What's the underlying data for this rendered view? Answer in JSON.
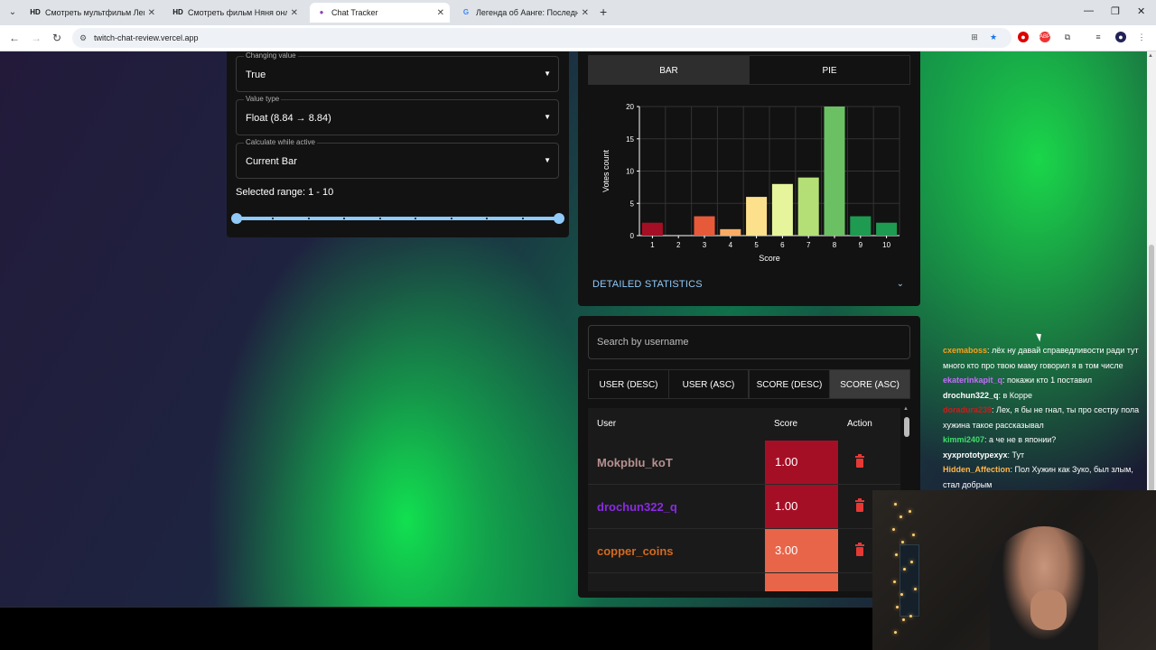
{
  "browser": {
    "tabs": [
      {
        "favicon": "HD",
        "title": "Смотреть мультфильм Легенд"
      },
      {
        "favicon": "HD",
        "title": "Смотреть фильм Няня онлайн"
      },
      {
        "favicon": "chat-tracker-icon",
        "title": "Chat Tracker"
      },
      {
        "favicon": "G",
        "title": "Легенда об Аанге: Последний"
      }
    ],
    "url": "twitch-chat-review.vercel.app"
  },
  "settings": {
    "changing_value_label": "Changing value",
    "changing_value": "True",
    "value_type_label": "Value type",
    "value_type": "Float (8.84 → 8.84)",
    "calculate_label": "Calculate while active",
    "calculate_value": "Current Bar",
    "range_text": "Selected range: 1 - 10",
    "range_min": 1,
    "range_max": 10
  },
  "chart_panel": {
    "tab_bar": "BAR",
    "tab_pie": "PIE",
    "details_label": "DETAILED STATISTICS"
  },
  "chart_data": {
    "type": "bar",
    "categories": [
      "1",
      "2",
      "3",
      "4",
      "5",
      "6",
      "7",
      "8",
      "9",
      "10"
    ],
    "values": [
      2,
      0,
      3,
      1,
      6,
      8,
      9,
      20,
      3,
      2
    ],
    "colors": [
      "#a50f26",
      "#a50f26",
      "#e65a3a",
      "#fbac64",
      "#fde08c",
      "#e6f59b",
      "#b4df77",
      "#6cc064",
      "#1e9b50",
      "#1e9b50"
    ],
    "xlabel": "Score",
    "ylabel": "Votes count",
    "ylim": [
      0,
      20
    ],
    "yticks": [
      0,
      5,
      10,
      15,
      20
    ],
    "grid": true
  },
  "table": {
    "search_placeholder": "Search by username",
    "sort_buttons": [
      "USER (DESC)",
      "USER (ASC)",
      "SCORE (DESC)",
      "SCORE (ASC)"
    ],
    "columns": [
      "User",
      "Score",
      "Action"
    ],
    "rows": [
      {
        "user": "Mokpblu_koT",
        "score": "1.00",
        "user_color": "#b89090",
        "score_color": "#a50f26"
      },
      {
        "user": "drochun322_q",
        "score": "1.00",
        "user_color": "#8a2be2",
        "score_color": "#a50f26"
      },
      {
        "user": "copper_coins",
        "score": "3.00",
        "user_color": "#d2691e",
        "score_color": "#e8654a"
      }
    ]
  },
  "chat": [
    {
      "nick": "cxemaboss",
      "text": "лёх ну давай справедливости ради тут много кто про твою маму говорил я в том числе",
      "color": "#ff9f1a"
    },
    {
      "nick": "ekaterinkapit_q",
      "text": "покажи кто 1 поставил",
      "color": "#c86bff"
    },
    {
      "nick": "drochun322_q",
      "text": "в Корре",
      "color": "#ffffff"
    },
    {
      "nick": "doradura239",
      "text": "Лех, я бы не гнал, ты про сестру пола хужина такое рассказывал",
      "color": "#d11a1a"
    },
    {
      "nick": "kimmi2407",
      "text": "а че не в японии?",
      "color": "#3ee06a"
    },
    {
      "nick": "xyxprototypexyx",
      "text": "Тут",
      "color": "#ffffff"
    },
    {
      "nick": "Hidden_Affection",
      "text": "Пол Хужин как Зуко, был злым, стал добрым",
      "color": "#ffb84a"
    }
  ]
}
